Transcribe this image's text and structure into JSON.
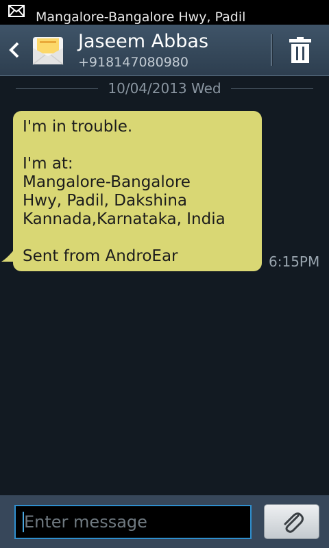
{
  "status_bar": {
    "notification_icon": "envelope-icon",
    "ticker_text": "Mangalore-Bangalore Hwy, Padil"
  },
  "header": {
    "back_icon": "chevron-left-icon",
    "avatar_icon": "envelope-avatar-icon",
    "contact_name": "Jaseem Abbas",
    "contact_number": "+918147080980",
    "delete_icon": "trash-icon"
  },
  "conversation": {
    "date_separator": "10/04/2013 Wed",
    "message": {
      "lines": [
        "I'm in trouble.",
        "",
        "I'm at:",
        "Mangalore-Bangalore",
        "Hwy, Padil,  Dakshina",
        "Kannada,Karnataka, India",
        "",
        "Sent from AndroEar"
      ],
      "time": "6:15PM",
      "bubble_color": "#d9d774"
    }
  },
  "composer": {
    "placeholder": "Enter message",
    "attach_icon": "paperclip-icon",
    "accent_color": "#2f8fce"
  }
}
